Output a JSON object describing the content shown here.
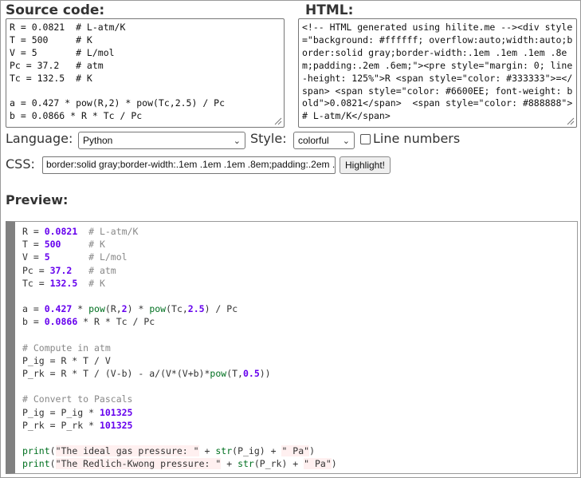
{
  "source_panel": {
    "title": "Source code:",
    "text": "R = 0.0821  # L-atm/K\nT = 500     # K\nV = 5       # L/mol\nPc = 37.2   # atm\nTc = 132.5  # K\n\na = 0.427 * pow(R,2) * pow(Tc,2.5) / Pc\nb = 0.0866 * R * Tc / Pc"
  },
  "html_panel": {
    "title": "HTML:",
    "text": "<!-- HTML generated using hilite.me --><div style=\"background: #ffffff; overflow:auto;width:auto;border:solid gray;border-width:.1em .1em .1em .8em;padding:.2em .6em;\"><pre style=\"margin: 0; line-height: 125%\">R <span style=\"color: #333333\">=</span> <span style=\"color: #6600EE; font-weight: bold\">0.0821</span>  <span style=\"color: #888888\"># L-atm/K</span>"
  },
  "options": {
    "language_label": "Language:",
    "language_value": "Python",
    "style_label": "Style:",
    "style_value": "colorful",
    "line_numbers_label": "Line numbers",
    "line_numbers_checked": false,
    "css_label": "CSS:",
    "css_value": "border:solid gray;border-width:.1em .1em .1em .8em;padding:.2em .6em;",
    "highlight_label": "Highlight!"
  },
  "preview": {
    "title": "Preview:",
    "colors": {
      "number": "#6600EE",
      "comment": "#888888",
      "builtin": "#007020",
      "string_bg": "#fff0f0",
      "border": "#808080"
    },
    "lines": [
      [
        {
          "t": "R = "
        },
        {
          "t": "0.0821",
          "c": "num"
        },
        {
          "t": "  "
        },
        {
          "t": "# L-atm/K",
          "c": "cmt"
        }
      ],
      [
        {
          "t": "T = "
        },
        {
          "t": "500",
          "c": "num"
        },
        {
          "t": "     "
        },
        {
          "t": "# K",
          "c": "cmt"
        }
      ],
      [
        {
          "t": "V = "
        },
        {
          "t": "5",
          "c": "num"
        },
        {
          "t": "       "
        },
        {
          "t": "# L/mol",
          "c": "cmt"
        }
      ],
      [
        {
          "t": "Pc = "
        },
        {
          "t": "37.2",
          "c": "num"
        },
        {
          "t": "   "
        },
        {
          "t": "# atm",
          "c": "cmt"
        }
      ],
      [
        {
          "t": "Tc = "
        },
        {
          "t": "132.5",
          "c": "num"
        },
        {
          "t": "  "
        },
        {
          "t": "# K",
          "c": "cmt"
        }
      ],
      [],
      [
        {
          "t": "a = "
        },
        {
          "t": "0.427",
          "c": "num"
        },
        {
          "t": " * "
        },
        {
          "t": "pow",
          "c": "fn"
        },
        {
          "t": "(R,"
        },
        {
          "t": "2",
          "c": "num"
        },
        {
          "t": ") * "
        },
        {
          "t": "pow",
          "c": "fn"
        },
        {
          "t": "(Tc,"
        },
        {
          "t": "2.5",
          "c": "num"
        },
        {
          "t": ") / Pc"
        }
      ],
      [
        {
          "t": "b = "
        },
        {
          "t": "0.0866",
          "c": "num"
        },
        {
          "t": " * R * Tc / Pc"
        }
      ],
      [],
      [
        {
          "t": "# Compute in atm",
          "c": "cmt"
        }
      ],
      [
        {
          "t": "P_ig = R * T / V"
        }
      ],
      [
        {
          "t": "P_rk = R * T / (V-b) - a/(V*(V+b)*"
        },
        {
          "t": "pow",
          "c": "fn"
        },
        {
          "t": "(T,"
        },
        {
          "t": "0.5",
          "c": "num"
        },
        {
          "t": "))"
        }
      ],
      [],
      [
        {
          "t": "# Convert to Pascals",
          "c": "cmt"
        }
      ],
      [
        {
          "t": "P_ig = P_ig * "
        },
        {
          "t": "101325",
          "c": "num"
        }
      ],
      [
        {
          "t": "P_rk = P_rk * "
        },
        {
          "t": "101325",
          "c": "num"
        }
      ],
      [],
      [
        {
          "t": "print",
          "c": "fn"
        },
        {
          "t": "("
        },
        {
          "t": "\"The ideal gas pressure: \"",
          "c": "str"
        },
        {
          "t": " + "
        },
        {
          "t": "str",
          "c": "fn"
        },
        {
          "t": "(P_ig) + "
        },
        {
          "t": "\" Pa\"",
          "c": "str"
        },
        {
          "t": ")"
        }
      ],
      [
        {
          "t": "print",
          "c": "fn"
        },
        {
          "t": "("
        },
        {
          "t": "\"The Redlich-Kwong pressure: \"",
          "c": "str"
        },
        {
          "t": " + "
        },
        {
          "t": "str",
          "c": "fn"
        },
        {
          "t": "(P_rk) + "
        },
        {
          "t": "\" Pa\"",
          "c": "str"
        },
        {
          "t": ")"
        }
      ]
    ]
  }
}
